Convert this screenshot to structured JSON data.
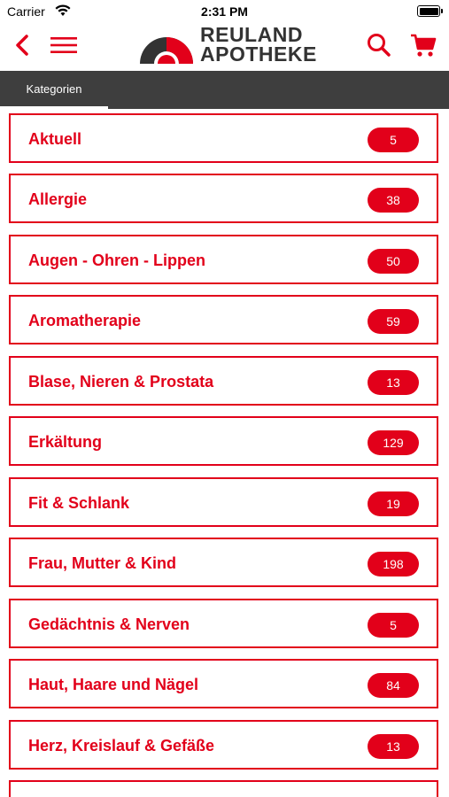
{
  "status_bar": {
    "carrier": "Carrier",
    "time": "2:31 PM"
  },
  "header": {
    "logo_line1": "REULAND",
    "logo_line2": "APOTHEKE",
    "icons": {
      "back": "chevron-left-icon",
      "menu": "hamburger-menu-icon",
      "search": "search-icon",
      "cart": "cart-icon"
    }
  },
  "tabs": [
    {
      "label": "Kategorien",
      "active": true
    }
  ],
  "colors": {
    "accent": "#e2001a",
    "tabbar": "#3e3e3e",
    "logo_dark": "#333333"
  },
  "categories": [
    {
      "label": "Aktuell",
      "count": "5"
    },
    {
      "label": "Allergie",
      "count": "38"
    },
    {
      "label": "Augen - Ohren - Lippen",
      "count": "50"
    },
    {
      "label": "Aromatherapie",
      "count": "59"
    },
    {
      "label": "Blase, Nieren & Prostata",
      "count": "13"
    },
    {
      "label": "Erkältung",
      "count": "129"
    },
    {
      "label": "Fit & Schlank",
      "count": "19"
    },
    {
      "label": "Frau, Mutter & Kind",
      "count": "198"
    },
    {
      "label": "Gedächtnis & Nerven",
      "count": "5"
    },
    {
      "label": "Haut, Haare und Nägel",
      "count": "84"
    },
    {
      "label": "Herz, Kreislauf & Gefäße",
      "count": "13"
    }
  ]
}
